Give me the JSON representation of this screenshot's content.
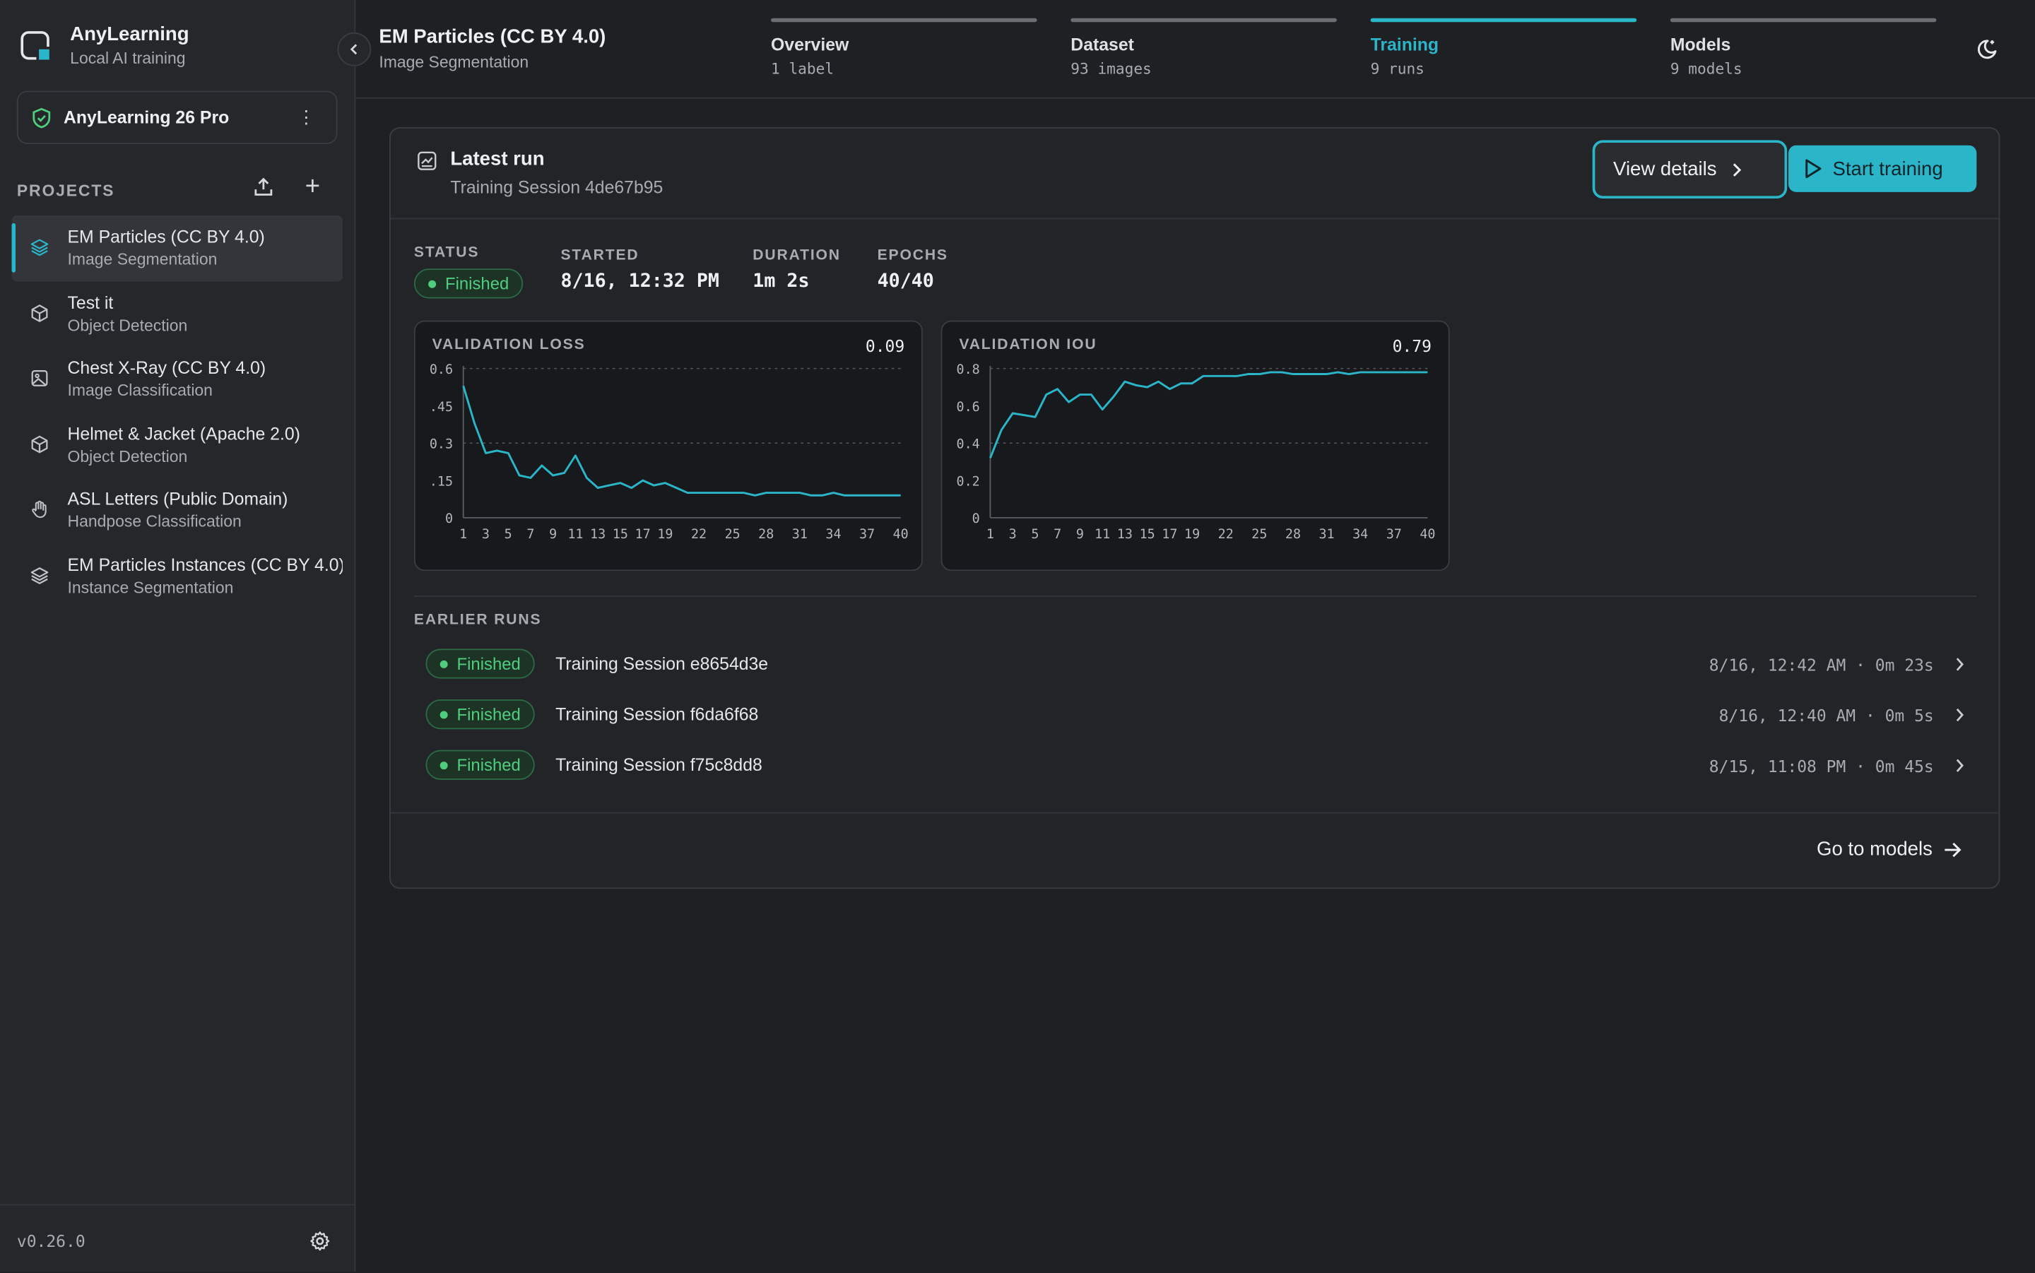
{
  "app": {
    "name": "AnyLearning",
    "tagline": "Local AI training",
    "version": "v0.26.0"
  },
  "license": {
    "label": "AnyLearning 26 Pro"
  },
  "projects_header": "PROJECTS",
  "projects": [
    {
      "name": "EM Particles (CC BY 4.0)",
      "type": "Image Segmentation",
      "icon": "layers-icon",
      "active": true
    },
    {
      "name": "Test it",
      "type": "Object Detection",
      "icon": "cube-icon"
    },
    {
      "name": "Chest X-Ray (CC BY 4.0)",
      "type": "Image Classification",
      "icon": "image-icon"
    },
    {
      "name": "Helmet & Jacket (Apache 2.0)",
      "type": "Object Detection",
      "icon": "cube-icon"
    },
    {
      "name": "ASL Letters (Public Domain)",
      "type": "Handpose Classification",
      "icon": "hand-icon"
    },
    {
      "name": "EM Particles Instances (CC BY 4.0)",
      "type": "Instance Segmentation",
      "icon": "layers-icon"
    }
  ],
  "header": {
    "title": "EM Particles (CC BY 4.0)",
    "subtitle": "Image Segmentation",
    "tabs": [
      {
        "label": "Overview",
        "count": "1 label"
      },
      {
        "label": "Dataset",
        "count": "93 images"
      },
      {
        "label": "Training",
        "count": "9 runs",
        "active": true
      },
      {
        "label": "Models",
        "count": "9 models"
      }
    ]
  },
  "latest": {
    "title": "Latest run",
    "session": "Training Session 4de67b95",
    "view_details": "View details",
    "start_training": "Start training",
    "status_label": "STATUS",
    "status": "Finished",
    "started_label": "STARTED",
    "started": "8/16, 12:32 PM",
    "duration_label": "DURATION",
    "duration": "1m 2s",
    "epochs_label": "EPOCHS",
    "epochs": "40/40"
  },
  "chart_data": [
    {
      "type": "line",
      "title": "VALIDATION LOSS",
      "current": "0.09",
      "x_ticks": [
        "1",
        "3",
        "5",
        "7",
        "9",
        "11",
        "13",
        "15",
        "17",
        "19",
        "22",
        "25",
        "28",
        "31",
        "34",
        "37",
        "40"
      ],
      "y_ticks": [
        "0",
        ".15",
        "0.3",
        ".45",
        "0.6"
      ],
      "ylim": [
        0,
        0.6
      ],
      "x": [
        1,
        2,
        3,
        4,
        5,
        6,
        7,
        8,
        9,
        10,
        11,
        12,
        13,
        14,
        15,
        16,
        17,
        18,
        19,
        20,
        21,
        22,
        23,
        24,
        25,
        26,
        27,
        28,
        29,
        30,
        31,
        32,
        33,
        34,
        35,
        36,
        37,
        38,
        39,
        40
      ],
      "values": [
        0.53,
        0.38,
        0.26,
        0.27,
        0.26,
        0.17,
        0.16,
        0.21,
        0.17,
        0.18,
        0.25,
        0.16,
        0.12,
        0.13,
        0.14,
        0.12,
        0.15,
        0.13,
        0.14,
        0.12,
        0.1,
        0.1,
        0.1,
        0.1,
        0.1,
        0.1,
        0.09,
        0.1,
        0.1,
        0.1,
        0.1,
        0.09,
        0.09,
        0.1,
        0.09,
        0.09,
        0.09,
        0.09,
        0.09,
        0.09
      ],
      "color": "#2bb5c9"
    },
    {
      "type": "line",
      "title": "VALIDATION IOU",
      "current": "0.79",
      "x_ticks": [
        "1",
        "3",
        "5",
        "7",
        "9",
        "11",
        "13",
        "15",
        "17",
        "19",
        "22",
        "25",
        "28",
        "31",
        "34",
        "37",
        "40"
      ],
      "y_ticks": [
        "0",
        "0.2",
        "0.4",
        "0.6",
        "0.8"
      ],
      "ylim": [
        0,
        0.8
      ],
      "x": [
        1,
        2,
        3,
        4,
        5,
        6,
        7,
        8,
        9,
        10,
        11,
        12,
        13,
        14,
        15,
        16,
        17,
        18,
        19,
        20,
        21,
        22,
        23,
        24,
        25,
        26,
        27,
        28,
        29,
        30,
        31,
        32,
        33,
        34,
        35,
        36,
        37,
        38,
        39,
        40
      ],
      "values": [
        0.32,
        0.47,
        0.56,
        0.55,
        0.54,
        0.66,
        0.69,
        0.62,
        0.66,
        0.66,
        0.58,
        0.65,
        0.73,
        0.71,
        0.7,
        0.73,
        0.69,
        0.72,
        0.72,
        0.76,
        0.76,
        0.76,
        0.76,
        0.77,
        0.77,
        0.78,
        0.78,
        0.77,
        0.77,
        0.77,
        0.77,
        0.78,
        0.77,
        0.78,
        0.78,
        0.78,
        0.78,
        0.78,
        0.78,
        0.78
      ],
      "color": "#2bb5c9"
    }
  ],
  "earlier": {
    "title": "EARLIER RUNS",
    "runs": [
      {
        "status": "Finished",
        "name": "Training Session e8654d3e",
        "info": "8/16, 12:42 AM · 0m 23s"
      },
      {
        "status": "Finished",
        "name": "Training Session f6da6f68",
        "info": "8/16, 12:40 AM · 0m 5s"
      },
      {
        "status": "Finished",
        "name": "Training Session f75c8dd8",
        "info": "8/15, 11:08 PM · 0m 45s"
      }
    ]
  },
  "go_to_models": "Go to models",
  "colors": {
    "accent": "#2bb5c9",
    "success": "#4fcf7e",
    "background": "#1f2023",
    "sidebar": "#26272b"
  }
}
